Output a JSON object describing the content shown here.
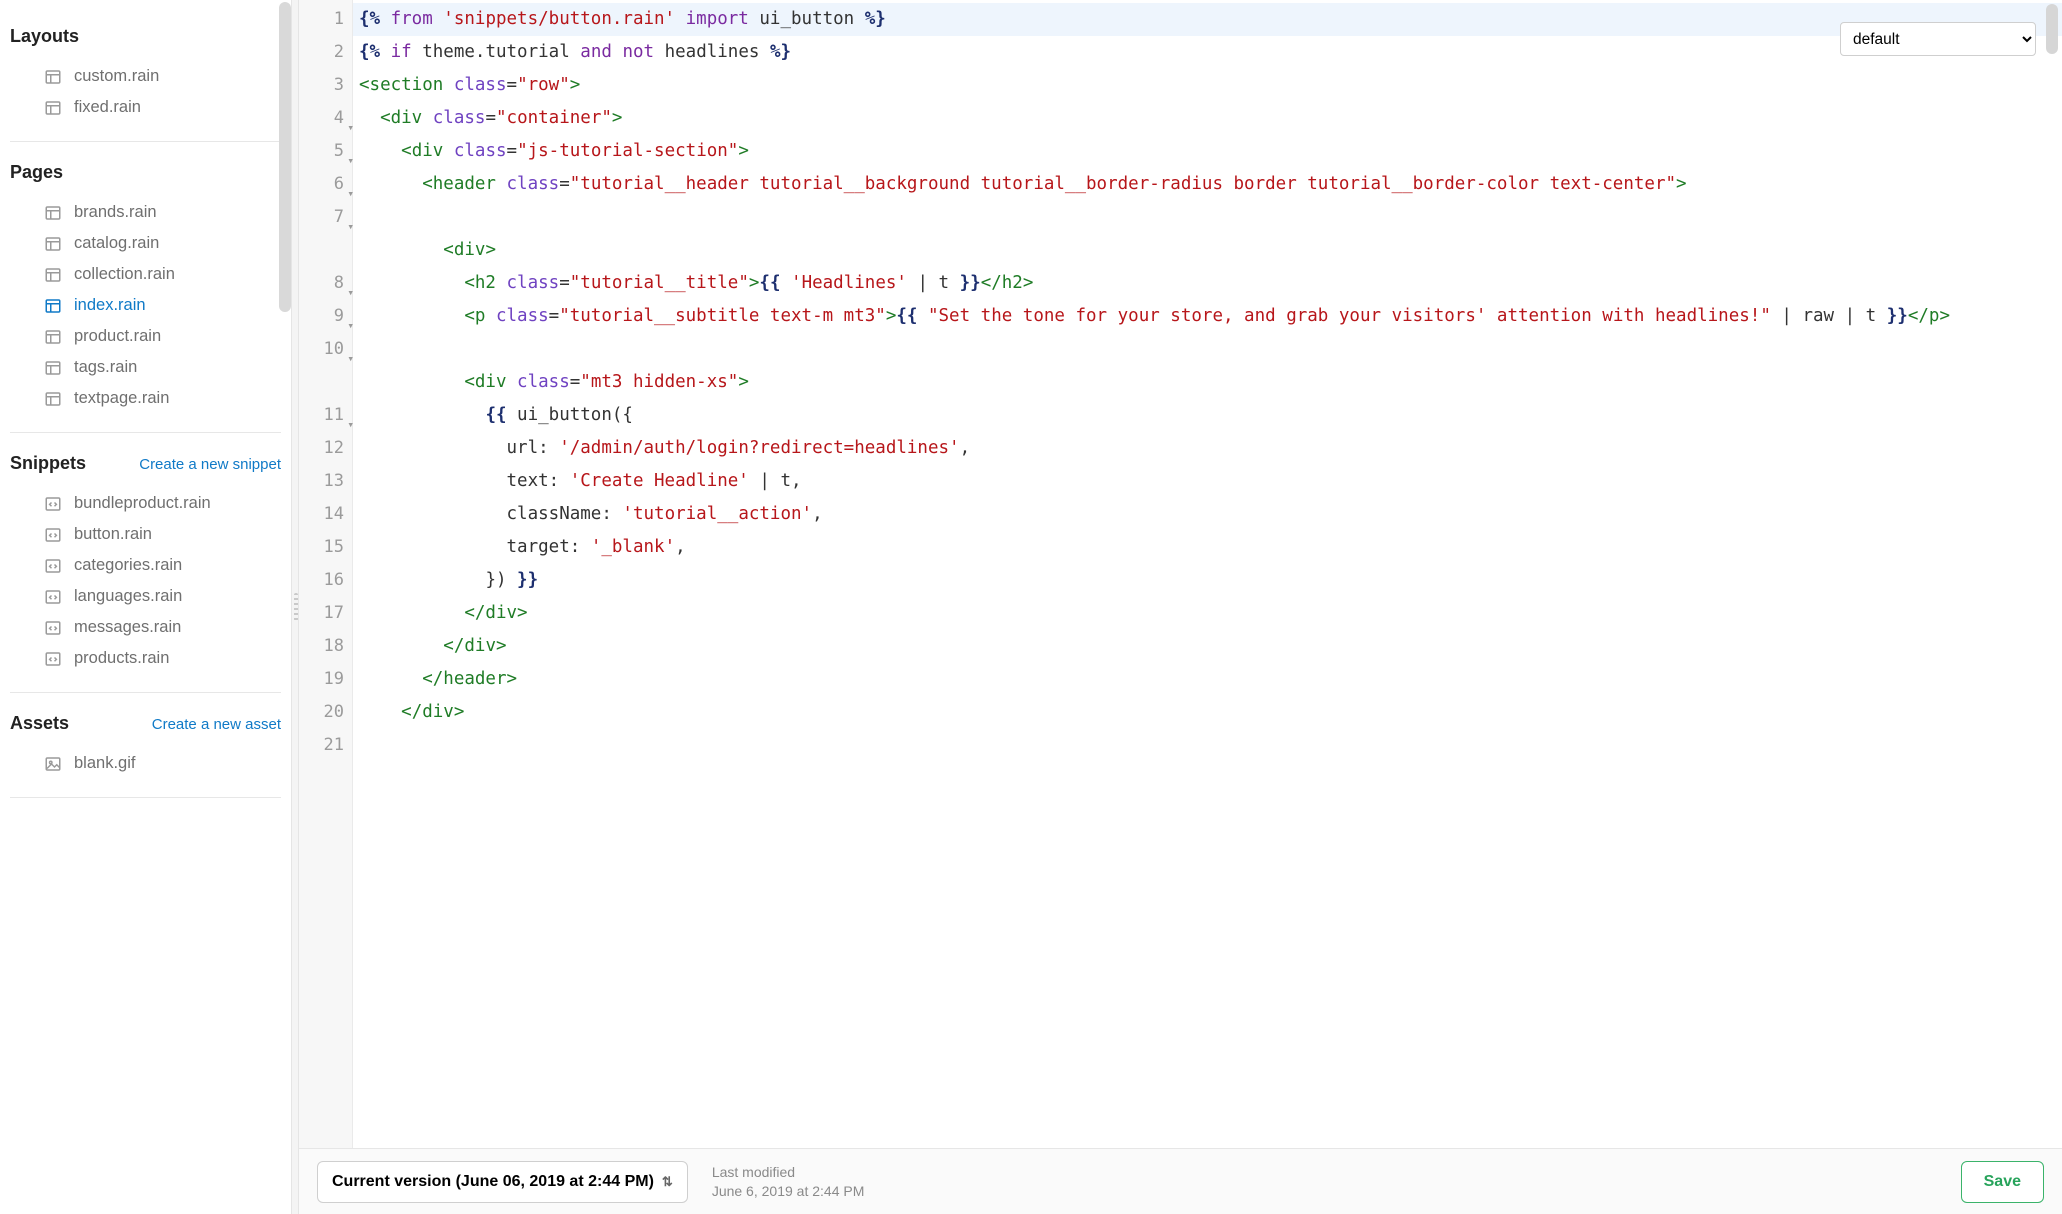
{
  "sidebar": {
    "sections": [
      {
        "title": "Layouts",
        "action": "",
        "items": [
          {
            "label": "custom.rain",
            "icon": "layout",
            "active": false
          },
          {
            "label": "fixed.rain",
            "icon": "layout",
            "active": false
          }
        ]
      },
      {
        "title": "Pages",
        "action": "",
        "items": [
          {
            "label": "brands.rain",
            "icon": "layout",
            "active": false
          },
          {
            "label": "catalog.rain",
            "icon": "layout",
            "active": false
          },
          {
            "label": "collection.rain",
            "icon": "layout",
            "active": false
          },
          {
            "label": "index.rain",
            "icon": "layout",
            "active": true
          },
          {
            "label": "product.rain",
            "icon": "layout",
            "active": false
          },
          {
            "label": "tags.rain",
            "icon": "layout",
            "active": false
          },
          {
            "label": "textpage.rain",
            "icon": "layout",
            "active": false
          }
        ]
      },
      {
        "title": "Snippets",
        "action": "Create a new snippet",
        "items": [
          {
            "label": "bundleproduct.rain",
            "icon": "code",
            "active": false
          },
          {
            "label": "button.rain",
            "icon": "code",
            "active": false
          },
          {
            "label": "categories.rain",
            "icon": "code",
            "active": false
          },
          {
            "label": "languages.rain",
            "icon": "code",
            "active": false
          },
          {
            "label": "messages.rain",
            "icon": "code",
            "active": false
          },
          {
            "label": "products.rain",
            "icon": "code",
            "active": false
          }
        ]
      },
      {
        "title": "Assets",
        "action": "Create a new asset",
        "items": [
          {
            "label": "blank.gif",
            "icon": "image",
            "active": false
          }
        ]
      }
    ]
  },
  "editor": {
    "dropdown": {
      "selected": "default"
    },
    "lines": [
      {
        "n": 1,
        "fold": "",
        "hl": true,
        "tokens": [
          [
            "{%",
            "navy"
          ],
          [
            " from ",
            "kw"
          ],
          [
            "'snippets/button.rain'",
            "str"
          ],
          [
            " import ",
            "kw"
          ],
          [
            "ui_button ",
            "id"
          ],
          [
            "%}",
            "navy"
          ]
        ]
      },
      {
        "n": 2,
        "fold": "",
        "hl": false,
        "tokens": [
          [
            "",
            "id"
          ]
        ]
      },
      {
        "n": 3,
        "fold": "",
        "hl": false,
        "tokens": [
          [
            "{%",
            "navy"
          ],
          [
            " if ",
            "kw"
          ],
          [
            "theme.tutorial ",
            "id"
          ],
          [
            "and ",
            "kw"
          ],
          [
            "not ",
            "kw"
          ],
          [
            "headlines ",
            "id"
          ],
          [
            "%}",
            "navy"
          ]
        ]
      },
      {
        "n": 4,
        "fold": "▾",
        "hl": false,
        "tokens": [
          [
            "<section ",
            "tag"
          ],
          [
            "class",
            "attr"
          ],
          [
            "=",
            "id"
          ],
          [
            "\"row\"",
            "str"
          ],
          [
            ">",
            "tag"
          ]
        ]
      },
      {
        "n": 5,
        "fold": "▾",
        "hl": false,
        "tokens": [
          [
            "  ",
            "id"
          ],
          [
            "<div ",
            "tag"
          ],
          [
            "class",
            "attr"
          ],
          [
            "=",
            "id"
          ],
          [
            "\"container\"",
            "str"
          ],
          [
            ">",
            "tag"
          ]
        ]
      },
      {
        "n": 6,
        "fold": "▾",
        "hl": false,
        "tokens": [
          [
            "    ",
            "id"
          ],
          [
            "<div ",
            "tag"
          ],
          [
            "class",
            "attr"
          ],
          [
            "=",
            "id"
          ],
          [
            "\"js-tutorial-section\"",
            "str"
          ],
          [
            ">",
            "tag"
          ]
        ]
      },
      {
        "n": 7,
        "fold": "▾",
        "hl": false,
        "tokens": [
          [
            "      ",
            "id"
          ],
          [
            "<header ",
            "tag"
          ],
          [
            "class",
            "attr"
          ],
          [
            "=",
            "id"
          ],
          [
            "\"tutorial__header tutorial__background tutorial__border-radius border tutorial__border-color text-center\"",
            "str"
          ],
          [
            ">",
            "tag"
          ]
        ]
      },
      {
        "n": 8,
        "fold": "▾",
        "hl": false,
        "tokens": [
          [
            "        ",
            "id"
          ],
          [
            "<div>",
            "tag"
          ]
        ]
      },
      {
        "n": 9,
        "fold": "▾",
        "hl": false,
        "tokens": [
          [
            "          ",
            "id"
          ],
          [
            "<h2 ",
            "tag"
          ],
          [
            "class",
            "attr"
          ],
          [
            "=",
            "id"
          ],
          [
            "\"tutorial__title\"",
            "str"
          ],
          [
            ">",
            "tag"
          ],
          [
            "{{ ",
            "navy"
          ],
          [
            "'Headlines'",
            "str"
          ],
          [
            " | t ",
            "id"
          ],
          [
            "}}",
            "navy"
          ],
          [
            "</h2>",
            "tag"
          ]
        ]
      },
      {
        "n": 10,
        "fold": "▾",
        "hl": false,
        "tokens": [
          [
            "          ",
            "id"
          ],
          [
            "<p ",
            "tag"
          ],
          [
            "class",
            "attr"
          ],
          [
            "=",
            "id"
          ],
          [
            "\"tutorial__subtitle text-m mt3\"",
            "str"
          ],
          [
            ">",
            "tag"
          ],
          [
            "{{ ",
            "navy"
          ],
          [
            "\"Set the tone for your store, and grab your visitors' attention with headlines!\"",
            "str"
          ],
          [
            " | raw | t ",
            "id"
          ],
          [
            "}}",
            "navy"
          ],
          [
            "</p>",
            "tag"
          ]
        ]
      },
      {
        "n": 11,
        "fold": "▾",
        "hl": false,
        "tokens": [
          [
            "          ",
            "id"
          ],
          [
            "<div ",
            "tag"
          ],
          [
            "class",
            "attr"
          ],
          [
            "=",
            "id"
          ],
          [
            "\"mt3 hidden-xs\"",
            "str"
          ],
          [
            ">",
            "tag"
          ]
        ]
      },
      {
        "n": 12,
        "fold": "",
        "hl": false,
        "tokens": [
          [
            "            ",
            "id"
          ],
          [
            "{{ ",
            "navy"
          ],
          [
            "ui_button({",
            "id"
          ]
        ]
      },
      {
        "n": 13,
        "fold": "",
        "hl": false,
        "tokens": [
          [
            "              url: ",
            "id"
          ],
          [
            "'/admin/auth/login?redirect=headlines'",
            "str"
          ],
          [
            ",",
            "id"
          ]
        ]
      },
      {
        "n": 14,
        "fold": "",
        "hl": false,
        "tokens": [
          [
            "              text: ",
            "id"
          ],
          [
            "'Create Headline'",
            "str"
          ],
          [
            " | t,",
            "id"
          ]
        ]
      },
      {
        "n": 15,
        "fold": "",
        "hl": false,
        "tokens": [
          [
            "              className: ",
            "id"
          ],
          [
            "'tutorial__action'",
            "str"
          ],
          [
            ",",
            "id"
          ]
        ]
      },
      {
        "n": 16,
        "fold": "",
        "hl": false,
        "tokens": [
          [
            "              target: ",
            "id"
          ],
          [
            "'_blank'",
            "str"
          ],
          [
            ",",
            "id"
          ]
        ]
      },
      {
        "n": 17,
        "fold": "",
        "hl": false,
        "tokens": [
          [
            "            }) ",
            "id"
          ],
          [
            "}}",
            "navy"
          ]
        ]
      },
      {
        "n": 18,
        "fold": "",
        "hl": false,
        "tokens": [
          [
            "          ",
            "id"
          ],
          [
            "</div>",
            "tag"
          ]
        ]
      },
      {
        "n": 19,
        "fold": "",
        "hl": false,
        "tokens": [
          [
            "        ",
            "id"
          ],
          [
            "</div>",
            "tag"
          ]
        ]
      },
      {
        "n": 20,
        "fold": "",
        "hl": false,
        "tokens": [
          [
            "      ",
            "id"
          ],
          [
            "</header>",
            "tag"
          ]
        ]
      },
      {
        "n": 21,
        "fold": "",
        "hl": false,
        "tokens": [
          [
            "    ",
            "id"
          ],
          [
            "</div>",
            "tag"
          ]
        ]
      }
    ]
  },
  "footer": {
    "version_label": "Current version (June 06, 2019 at 2:44 PM)",
    "meta_title": "Last modified",
    "meta_value": "June 6, 2019 at 2:44 PM",
    "save_label": "Save"
  }
}
